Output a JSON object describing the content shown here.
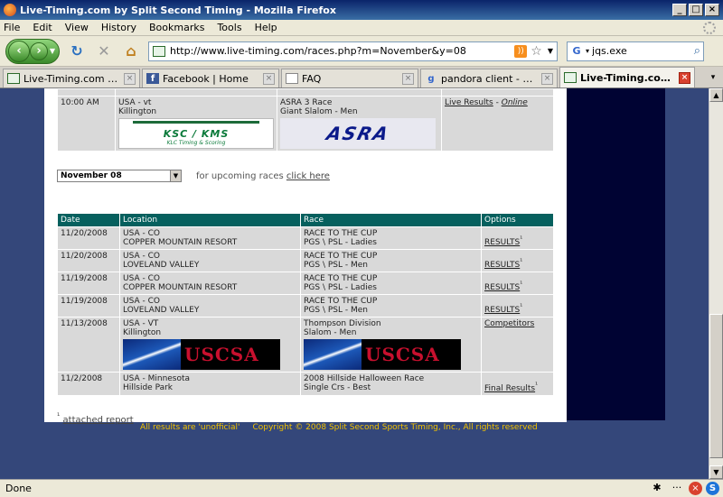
{
  "window": {
    "title": "Live-Timing.com by Split Second Timing - Mozilla Firefox"
  },
  "menu": [
    "File",
    "Edit",
    "View",
    "History",
    "Bookmarks",
    "Tools",
    "Help"
  ],
  "nav": {
    "url": "http://www.live-timing.com/races.php?m=November&y=08",
    "search_value": "jqs.exe"
  },
  "tabs": [
    {
      "label": "Live-Timing.com by Split ...",
      "icon": "live-timing-icon",
      "active": false
    },
    {
      "label": "Facebook | Home",
      "icon": "facebook-icon",
      "active": false
    },
    {
      "label": "FAQ",
      "icon": "document-icon",
      "active": false
    },
    {
      "label": "pandora client - Google S...",
      "icon": "google-icon",
      "active": false
    },
    {
      "label": "Live-Timing.com by ...",
      "icon": "live-timing-icon",
      "active": true
    }
  ],
  "top_row": {
    "time": "10:00 AM",
    "location_line1": "USA - vt",
    "location_line2": "Killington",
    "race_line1": "ASRA 3 Race",
    "race_line2": "Giant Slalom - Men",
    "option_link": "Live Results",
    "option_sep": " - ",
    "option_status": "Online",
    "logo1_text": "KSC / KMS",
    "logo1_sub": "KLC Timing & Scoring",
    "logo2_text": "ASRA"
  },
  "month_select": {
    "value": "November 08"
  },
  "upcoming": {
    "text": "for upcoming races ",
    "link": "click here"
  },
  "table": {
    "headers": [
      "Date",
      "Location",
      "Race",
      "Options"
    ],
    "rows": [
      {
        "date": "11/20/2008",
        "loc1": "USA - CO",
        "loc2": "COPPER MOUNTAIN RESORT",
        "race1": "RACE TO THE CUP",
        "race2": "PGS \\ PSL - Ladies",
        "option": "RESULTS",
        "sup": "¹"
      },
      {
        "date": "11/20/2008",
        "loc1": "USA - CO",
        "loc2": "LOVELAND VALLEY",
        "race1": "RACE TO THE CUP",
        "race2": "PGS \\ PSL - Men",
        "option": "RESULTS",
        "sup": "¹"
      },
      {
        "date": "11/19/2008",
        "loc1": "USA - CO",
        "loc2": "COPPER MOUNTAIN RESORT",
        "race1": "RACE TO THE CUP",
        "race2": "PGS \\ PSL - Ladies",
        "option": "RESULTS",
        "sup": "¹"
      },
      {
        "date": "11/19/2008",
        "loc1": "USA - CO",
        "loc2": "LOVELAND VALLEY",
        "race1": "RACE TO THE CUP",
        "race2": "PGS \\ PSL - Men",
        "option": "RESULTS",
        "sup": "¹"
      },
      {
        "date": "11/13/2008",
        "loc1": "USA - VT",
        "loc2": "Killington",
        "race1": "Thompson Division",
        "race2": "Slalom - Men",
        "option": "Competitors",
        "sup": "",
        "logo": "USCSA"
      },
      {
        "date": "11/2/2008",
        "loc1": "USA - Minnesota",
        "loc2": "Hillside Park",
        "race1": "2008 Hillside Halloween Race",
        "race2": "Single Crs - Best",
        "option": "Final Results",
        "sup": "¹"
      }
    ]
  },
  "footnote": {
    "mark": "¹",
    "link": "attached report"
  },
  "footer": {
    "unofficial": "All results are 'unofficial'",
    "copyright": "Copyright © 2008 Split Second Sports Timing, Inc., All rights reserved"
  },
  "status": {
    "text": "Done"
  },
  "colors": {
    "header_teal": "#06605e",
    "page_bg": "#34477a",
    "footer_yellow": "#f2c200"
  }
}
